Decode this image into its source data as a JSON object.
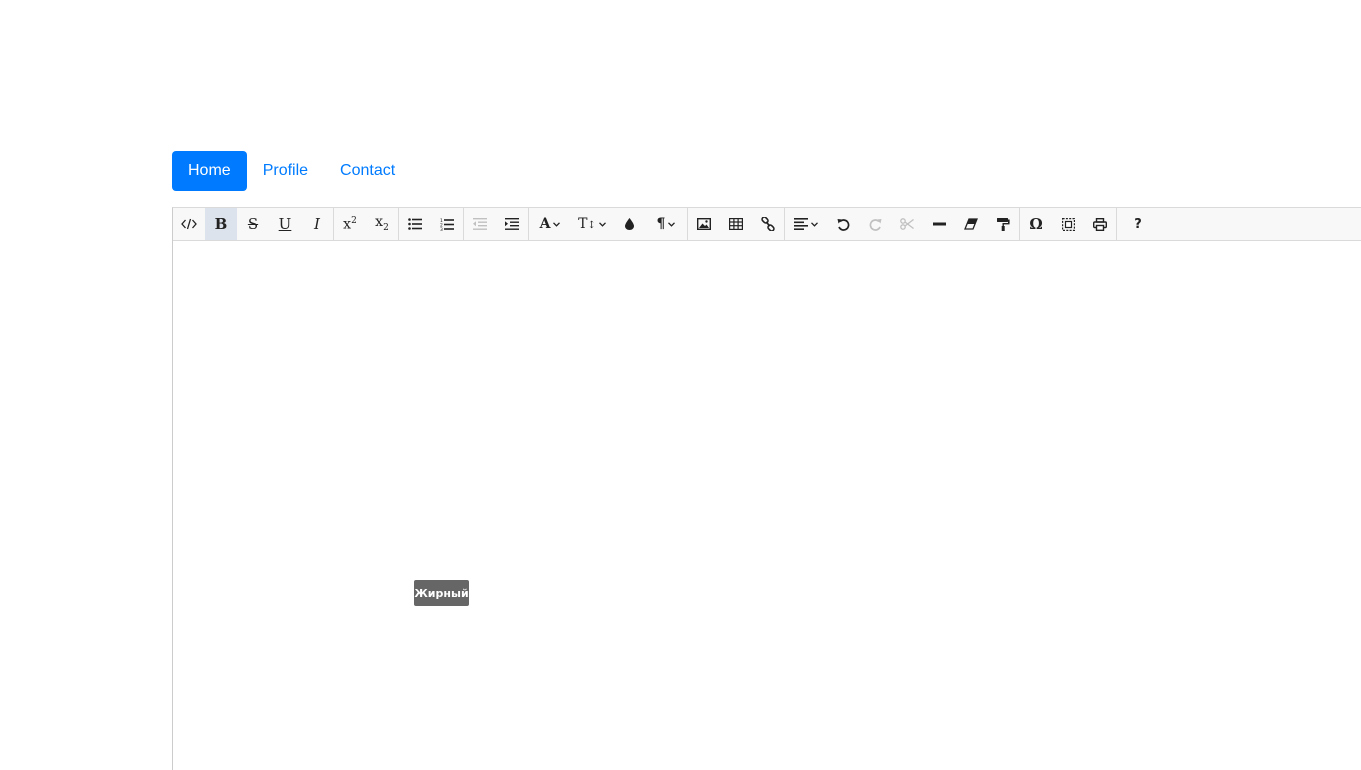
{
  "nav": {
    "tabs": [
      {
        "label": "Home",
        "active": true
      },
      {
        "label": "Profile",
        "active": false
      },
      {
        "label": "Contact",
        "active": false
      }
    ]
  },
  "toolbar": {
    "groups": [
      [
        "source-code-icon",
        "bold-icon",
        "strikethrough-icon",
        "underline-icon",
        "italic-icon"
      ],
      [
        "superscript-icon",
        "subscript-icon"
      ],
      [
        "unordered-list-icon",
        "ordered-list-icon"
      ],
      [
        "outdent-icon",
        "indent-icon"
      ],
      [
        "font-icon",
        "font-size-icon",
        "brush-icon",
        "paragraph-icon"
      ],
      [
        "image-icon",
        "table-icon",
        "link-icon"
      ],
      [
        "align-icon",
        "undo-icon",
        "redo-icon",
        "cut-icon",
        "horizontal-rule-icon",
        "eraser-icon",
        "copy-format-icon"
      ],
      [
        "symbol-icon",
        "select-all-icon",
        "print-icon"
      ],
      [
        "help-icon"
      ]
    ],
    "active_button": "bold-icon",
    "disabled_buttons": [
      "outdent-icon",
      "redo-icon",
      "cut-icon"
    ],
    "tooltip": "Жирный"
  },
  "colors": {
    "primary": "#007bff",
    "toolbar_bg": "#f8f8f8",
    "active_button_bg": "#dde3ec",
    "tooltip_bg": "#666666"
  }
}
